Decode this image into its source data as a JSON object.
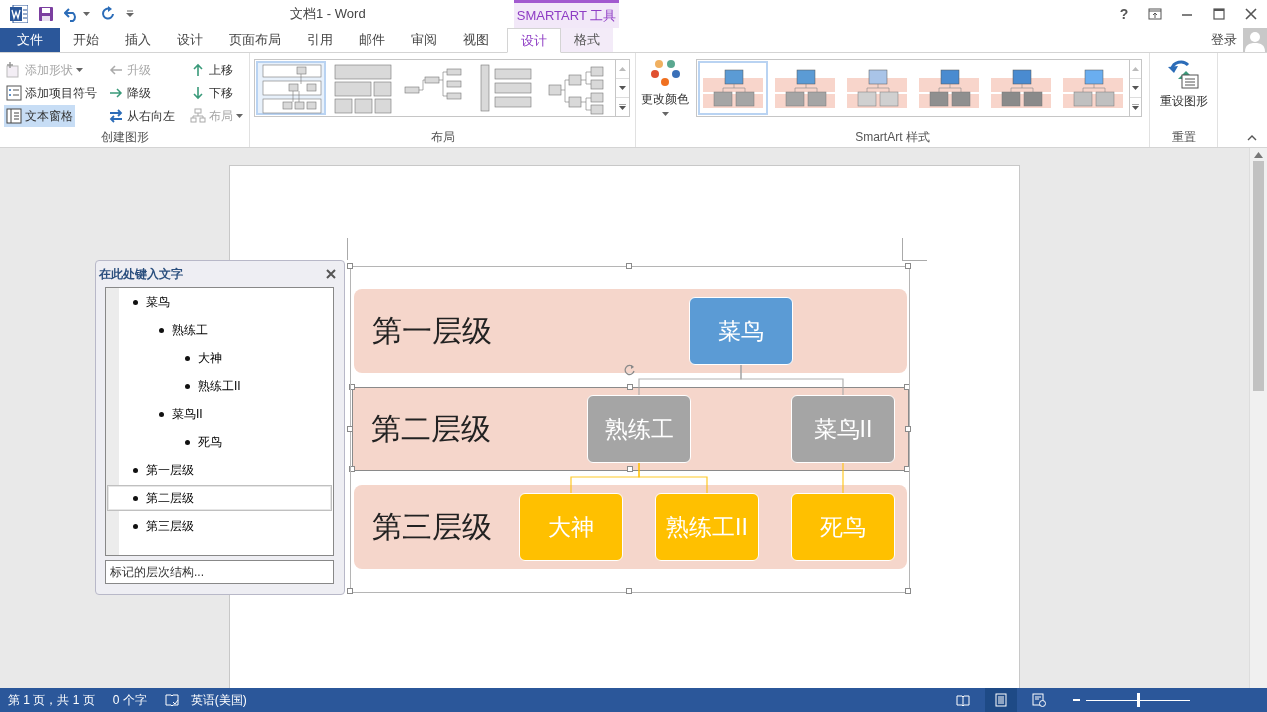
{
  "window": {
    "title": "文档1 - Word",
    "context_group": "SMARTART 工具",
    "help": "?",
    "sign_in": "登录"
  },
  "tabs": [
    {
      "label": "文件",
      "kind": "file",
      "selected": false
    },
    {
      "label": "开始",
      "kind": "normal",
      "selected": false
    },
    {
      "label": "插入",
      "kind": "normal",
      "selected": false
    },
    {
      "label": "设计",
      "kind": "normal",
      "selected": false
    },
    {
      "label": "页面布局",
      "kind": "normal",
      "selected": false
    },
    {
      "label": "引用",
      "kind": "normal",
      "selected": false
    },
    {
      "label": "邮件",
      "kind": "normal",
      "selected": false
    },
    {
      "label": "审阅",
      "kind": "normal",
      "selected": false
    },
    {
      "label": "视图",
      "kind": "normal",
      "selected": false
    },
    {
      "label": "设计",
      "kind": "context",
      "selected": true
    },
    {
      "label": "格式",
      "kind": "context",
      "selected": false
    }
  ],
  "ribbon": {
    "create_graphic": {
      "label": "创建图形",
      "buttons": [
        {
          "label": "添加形状",
          "disabled": true,
          "pressed": false,
          "has_menu": true
        },
        {
          "label": "添加项目符号",
          "disabled": false,
          "pressed": false,
          "has_menu": false
        },
        {
          "label": "文本窗格",
          "disabled": false,
          "pressed": true,
          "has_menu": false
        },
        {
          "label": "升级",
          "disabled": true,
          "pressed": false,
          "has_menu": false
        },
        {
          "label": "降级",
          "disabled": false,
          "pressed": false,
          "has_menu": false
        },
        {
          "label": "从右向左",
          "disabled": false,
          "pressed": false,
          "has_menu": false
        },
        {
          "label": "上移",
          "disabled": false,
          "pressed": false,
          "has_menu": false
        },
        {
          "label": "下移",
          "disabled": false,
          "pressed": false,
          "has_menu": false
        },
        {
          "label": "布局",
          "disabled": true,
          "pressed": false,
          "has_menu": true
        }
      ]
    },
    "layouts": {
      "label": "布局",
      "options": [
        {
          "selected": true
        },
        {
          "selected": false
        },
        {
          "selected": false
        },
        {
          "selected": false
        },
        {
          "selected": false
        }
      ]
    },
    "change_colors": {
      "label": "更改颜色"
    },
    "styles": {
      "label": "SmartArt 样式",
      "options": [
        {
          "selected": true
        },
        {
          "selected": false
        },
        {
          "selected": false
        },
        {
          "selected": false
        },
        {
          "selected": false
        },
        {
          "selected": false
        }
      ]
    },
    "reset": {
      "label": "重置",
      "button": "重设图形"
    }
  },
  "text_pane": {
    "title": "在此处键入文字",
    "items": [
      {
        "text": "菜鸟",
        "selected": false,
        "children": [
          {
            "text": "熟练工",
            "selected": false,
            "children": [
              {
                "text": "大神",
                "selected": false
              },
              {
                "text": "熟练工II",
                "selected": false
              }
            ]
          },
          {
            "text": "菜鸟II",
            "selected": false,
            "children": [
              {
                "text": "死鸟",
                "selected": false
              }
            ]
          }
        ]
      },
      {
        "text": "第一层级",
        "selected": false
      },
      {
        "text": "第二层级",
        "selected": true
      },
      {
        "text": "第三层级",
        "selected": false
      }
    ],
    "footer_link": "标记的层次结构..."
  },
  "diagram": {
    "levels": [
      {
        "label": "第一层级",
        "selected": false
      },
      {
        "label": "第二层级",
        "selected": true
      },
      {
        "label": "第三层级",
        "selected": false
      }
    ],
    "nodes": [
      {
        "text": "菜鸟",
        "color": "#5b9bd5",
        "children": [
          {
            "text": "熟练工",
            "color": "#a5a5a5",
            "children": [
              {
                "text": "大神",
                "color": "#ffc000"
              },
              {
                "text": "熟练工II",
                "color": "#ffc000"
              }
            ]
          },
          {
            "text": "菜鸟II",
            "color": "#a5a5a5",
            "children": [
              {
                "text": "死鸟",
                "color": "#ffc000"
              }
            ]
          }
        ]
      }
    ]
  },
  "status_bar": {
    "page": "第 1 页，共 1 页",
    "words": "0 个字",
    "language": "英语(美国)",
    "views": [
      {
        "selected": false
      },
      {
        "selected": true
      },
      {
        "selected": false
      }
    ],
    "zoom": {
      "level": 0.5
    }
  }
}
